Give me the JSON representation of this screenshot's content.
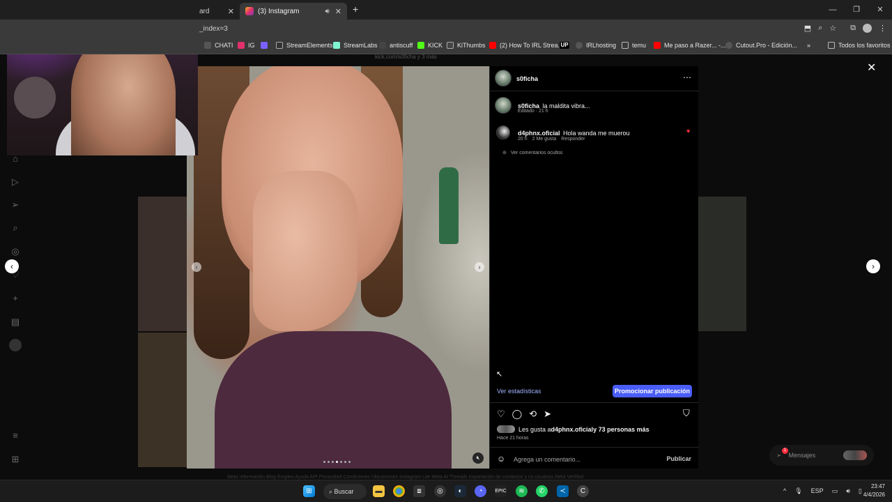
{
  "browser": {
    "tabs": [
      {
        "label": "ard",
        "active": false
      },
      {
        "label": "(3) Instagram",
        "active": true
      }
    ],
    "new_tab": "+",
    "url": "_index=3",
    "window_controls": [
      "—",
      "❐",
      "✕"
    ]
  },
  "bookmarks": [
    {
      "label": "CHATI",
      "icon": "chati-icon",
      "color": "#555"
    },
    {
      "label": "IG",
      "icon": "instagram-icon",
      "color": "#e1306c"
    },
    {
      "label": "",
      "icon": "chart-icon",
      "color": "#7b61ff"
    },
    {
      "label": "StreamElements",
      "icon": "streamelements-icon",
      "color": "#333"
    },
    {
      "label": "StreamLabs",
      "icon": "streamlabs-icon",
      "color": "#80f5d2"
    },
    {
      "label": "antiscuff",
      "icon": "antiscuff-icon",
      "color": "#444"
    },
    {
      "label": "KICK",
      "icon": "kick-icon",
      "color": "#53fc18"
    },
    {
      "label": "KiThumbs",
      "icon": "kithumbs-icon",
      "color": "#444"
    },
    {
      "label": "(2) How To IRL Strea...",
      "icon": "youtube-icon",
      "color": "#ff0000"
    },
    {
      "label": "",
      "icon": "up-icon",
      "color": "#000"
    },
    {
      "label": "IRLhosting",
      "icon": "irlhosting-icon",
      "color": "#555"
    },
    {
      "label": "temu",
      "icon": "folder-icon",
      "color": "#666"
    },
    {
      "label": "Me paso a Razer... -...",
      "icon": "youtube-icon",
      "color": "#ff0000"
    },
    {
      "label": "Cutout.Pro - Edición...",
      "icon": "cutout-icon",
      "color": "#555"
    },
    {
      "label": "Todos los favoritos",
      "icon": "folder-icon",
      "color": "#666"
    }
  ],
  "stream_overlay_text": "kick.com/s0ficha y 3 más",
  "post": {
    "author": "s0ficha",
    "caption_user": "s0ficha",
    "caption_text": "la maldita vibra...",
    "caption_meta": "Editado · 21 h",
    "comment": {
      "user": "d4phnx.oficial",
      "text": "Hola wanda me muerou",
      "time": "20 h",
      "likes": "2 Me gusta",
      "reply": "Responder"
    },
    "hidden_comments": "Ver comentarios ocultos",
    "stats_link": "Ver estadísticas",
    "promote_button": "Promocionar publicación",
    "likes_text_prefix": "Les gusta a ",
    "likes_user": "d4phnx.oficial",
    "likes_text_suffix": " y 73 personas más",
    "posted": "Hace 21 horas",
    "comment_placeholder": "Agrega un comentario...",
    "publish": "Publicar"
  },
  "messages": {
    "label": "Mensajes",
    "badge": "1"
  },
  "footer_links": "Meta   Información   Blog   Empleo   Ayuda   API   Privacidad   Condiciones   Ubicaciones   Instagram Lite   Meta AI   Threads   Importación de contactos y no usuarios   Meta Verified",
  "taskbar": {
    "search_label": "Buscar",
    "language": "ESP",
    "time": "23:47",
    "date": "4/4/2026"
  }
}
